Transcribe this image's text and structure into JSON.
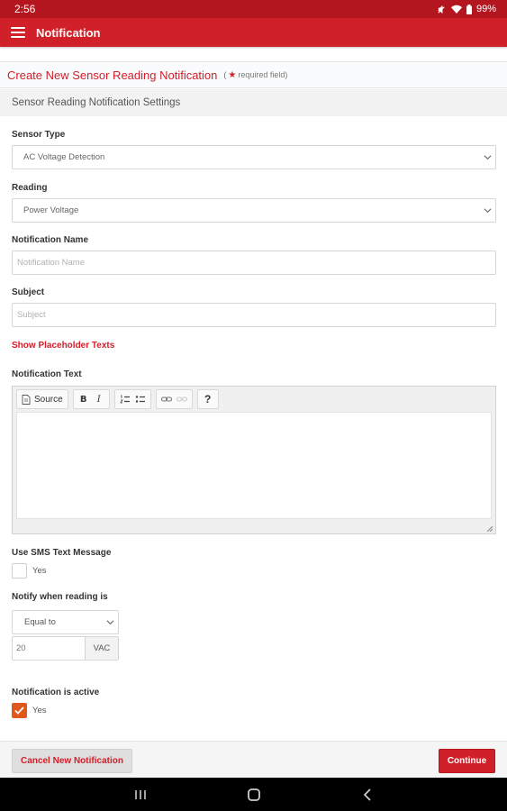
{
  "status_bar": {
    "time": "2:56",
    "battery": "99%"
  },
  "app_bar": {
    "title": "Notification"
  },
  "page": {
    "title": "Create New Sensor Reading Notification",
    "required_note": "required field"
  },
  "section": {
    "title": "Sensor Reading Notification Settings"
  },
  "form": {
    "sensor_type": {
      "label": "Sensor Type",
      "value": "AC Voltage Detection"
    },
    "reading": {
      "label": "Reading",
      "value": "Power Voltage"
    },
    "notification_name": {
      "label": "Notification Name",
      "value": "",
      "placeholder": "Notification Name"
    },
    "subject": {
      "label": "Subject",
      "value": "",
      "placeholder": "Subject"
    },
    "placeholder_link": "Show Placeholder Texts",
    "notification_text": {
      "label": "Notification Text",
      "toolbar": {
        "source": "Source",
        "bold": "B",
        "italic": "I",
        "help": "?"
      }
    },
    "sms": {
      "label": "Use SMS Text Message",
      "option": "Yes",
      "checked": false
    },
    "notify_when": {
      "label": "Notify when reading is",
      "comparator": "Equal to",
      "value": "20",
      "unit": "VAC"
    },
    "active": {
      "label": "Notification is active",
      "option": "Yes",
      "checked": true
    }
  },
  "footer": {
    "cancel_label": "Cancel New Notification",
    "continue_label": "Continue"
  },
  "colors": {
    "accent": "#d0202a",
    "status_bar": "#b3161e",
    "checkbox_checked": "#e0581b"
  }
}
